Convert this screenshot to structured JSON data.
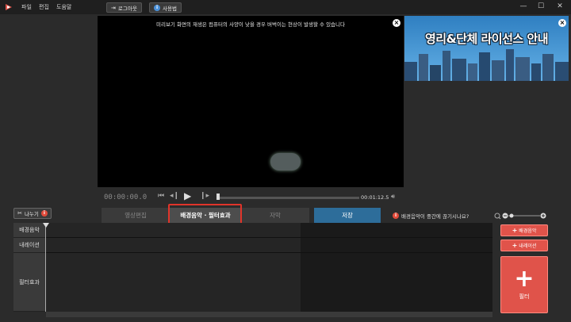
{
  "menu": {
    "file": "파일",
    "edit": "편집",
    "help": "도움말"
  },
  "toolbar": {
    "logout": "로그아웃",
    "usage": "사용법"
  },
  "window": {
    "minimize": "—",
    "maximize": "☐",
    "close": "✕"
  },
  "preview": {
    "notice": "미리보기 화면의 재생은 컴퓨터의 사양이 낮을 경우 버벅이는 현상이 발생할 수 있습니다",
    "timecode": "00:00:00.0",
    "duration": "00:01:12.5"
  },
  "ad": {
    "text": "영리&단체 라이선스 안내"
  },
  "cut_button": {
    "label": "나누기"
  },
  "tabs": [
    {
      "label": "영상편집"
    },
    {
      "label": "배경음악 · 필터효과"
    },
    {
      "label": "자막"
    },
    {
      "label": "저장"
    }
  ],
  "bgm_question": "배경음악이 중간에 끊기시나요?",
  "timeline": {
    "rows": [
      {
        "label": "배경음악"
      },
      {
        "label": "내레이션"
      },
      {
        "label": "필터효과"
      }
    ]
  },
  "actions": {
    "bgm": "배경음악",
    "narration": "내레이션",
    "filter": "필터"
  },
  "colors": {
    "accent_red": "#e0534a",
    "save_blue": "#2d6d9a",
    "highlight": "#e0342a"
  }
}
